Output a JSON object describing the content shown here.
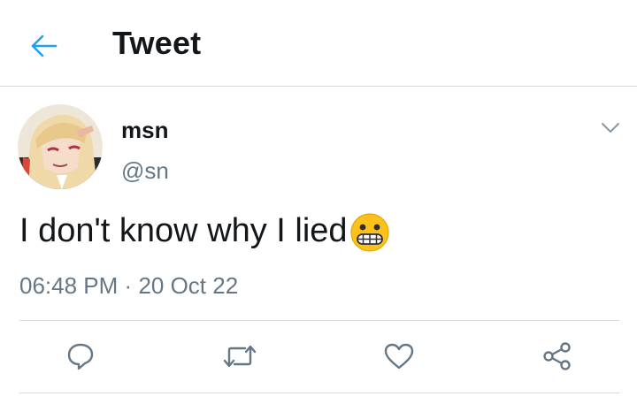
{
  "header": {
    "title": "Tweet",
    "back_icon": "arrow-left-icon"
  },
  "tweet": {
    "display_name": "msn",
    "handle": "@sn",
    "text": "I don't know why I lied",
    "emoji": "grimacing-face-emoji",
    "time": "06:48 PM",
    "separator": "·",
    "date": "20 Oct 22"
  },
  "actions": [
    {
      "name": "reply",
      "icon": "speech-bubble-icon"
    },
    {
      "name": "retweet",
      "icon": "retweet-arrows-icon"
    },
    {
      "name": "like",
      "icon": "heart-icon"
    },
    {
      "name": "share",
      "icon": "share-nodes-icon"
    }
  ],
  "colors": {
    "accent": "#1da1f2",
    "text": "#14171a",
    "secondary": "#657786",
    "icon": "#657786",
    "divider": "#d6dbdf"
  }
}
